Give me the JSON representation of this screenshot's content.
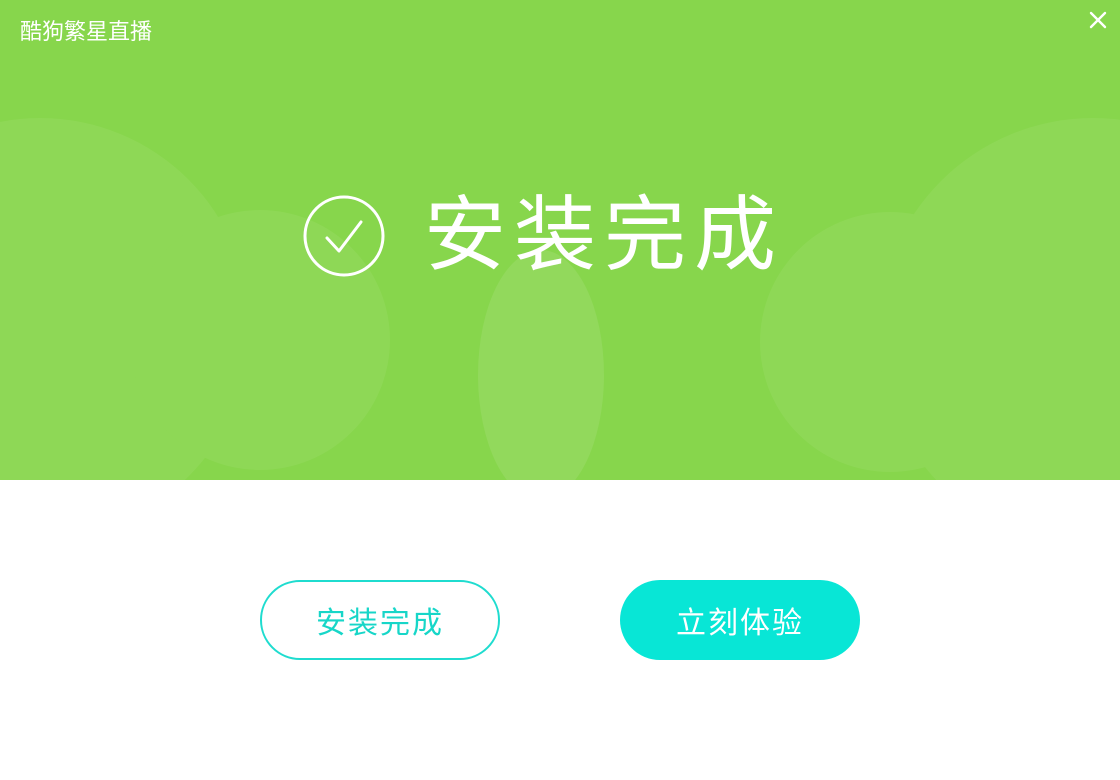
{
  "window": {
    "app_title": "酷狗繁星直播",
    "close_icon": "close-icon"
  },
  "hero": {
    "status_icon": "check-circle-icon",
    "status_text": "安装完成"
  },
  "actions": {
    "finish_label": "安装完成",
    "try_now_label": "立刻体验"
  },
  "colors": {
    "banner_green": "#87d64c",
    "accent_cyan": "#08e6d6",
    "white": "#ffffff"
  }
}
